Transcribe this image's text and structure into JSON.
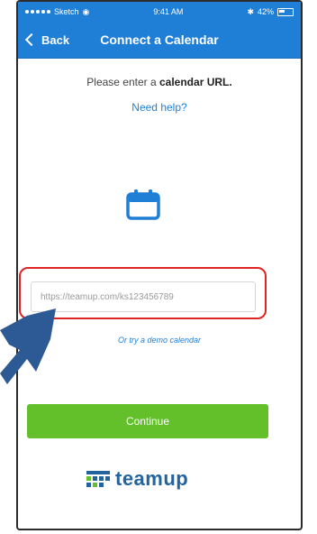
{
  "status_bar": {
    "carrier": "Sketch",
    "time": "9:41 AM",
    "battery": "42%"
  },
  "nav": {
    "back_label": "Back",
    "title": "Connect a Calendar"
  },
  "content": {
    "prompt_prefix": "Please enter a ",
    "prompt_bold": "calendar URL.",
    "help_link": "Need help?",
    "url_placeholder": "https://teamup.com/ks123456789",
    "demo_link": "Or try a demo calendar",
    "continue_label": "Continue"
  },
  "logo": {
    "text": "teamup"
  },
  "colors": {
    "primary": "#1f7fd6",
    "accent_green": "#63c02b",
    "highlight_red": "#e02424",
    "logo_blue": "#23649e"
  }
}
